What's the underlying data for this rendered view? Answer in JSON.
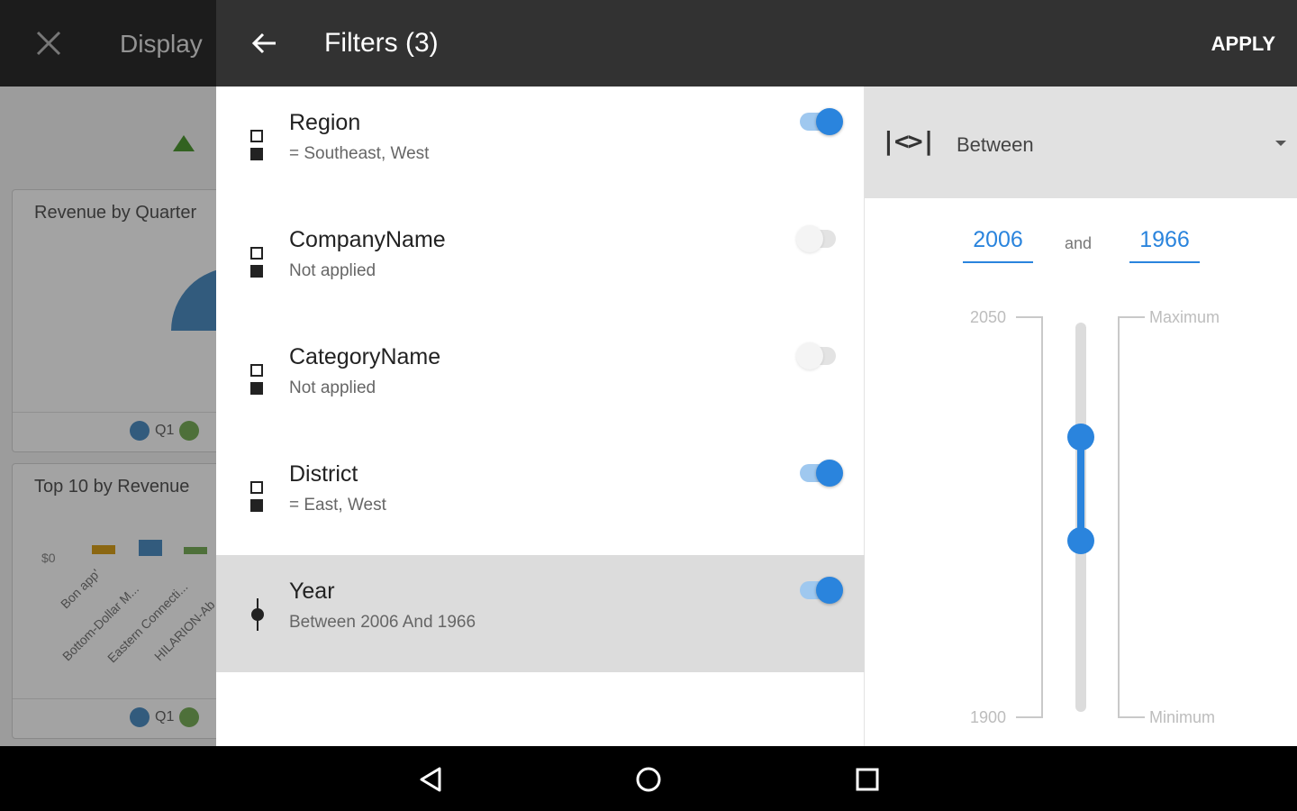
{
  "background": {
    "title": "Display",
    "cards": [
      {
        "title": "Revenue by Quarter",
        "legend": [
          "Q1"
        ]
      },
      {
        "title": "Top 10 by Revenue",
        "legend": [
          "Q1"
        ],
        "axis_label": "$0",
        "categories": [
          "Bon app'",
          "Bottom-Dollar M...",
          "Eastern Connecti...",
          "HILARION-Ab"
        ]
      }
    ]
  },
  "header": {
    "title": "Filters (3)",
    "apply_label": "APPLY"
  },
  "filters": [
    {
      "name": "Region",
      "summary": "= Southeast, West",
      "enabled": true,
      "icon": "list-filter-icon"
    },
    {
      "name": "CompanyName",
      "summary": "Not applied",
      "enabled": false,
      "icon": "list-filter-icon"
    },
    {
      "name": "CategoryName",
      "summary": "Not applied",
      "enabled": false,
      "icon": "list-filter-icon"
    },
    {
      "name": "District",
      "summary": "= East, West",
      "enabled": true,
      "icon": "list-filter-icon"
    },
    {
      "name": "Year",
      "summary": "Between 2006 And 1966",
      "enabled": true,
      "icon": "range-filter-icon",
      "selected": true
    }
  ],
  "editor": {
    "operator_icon": "|<>|",
    "operator": "Between",
    "from": "2006",
    "to": "1966",
    "and_label": "and",
    "scale_max": "2050",
    "scale_min": "1900",
    "maximum_label": "Maximum",
    "minimum_label": "Minimum",
    "scale": {
      "min": 1900,
      "max": 2050
    }
  },
  "colors": {
    "accent": "#2a84dd",
    "header": "#323232",
    "selected_row": "#dcdcdc",
    "q1": "#4f8fc4",
    "q2": "#7bb05b"
  }
}
